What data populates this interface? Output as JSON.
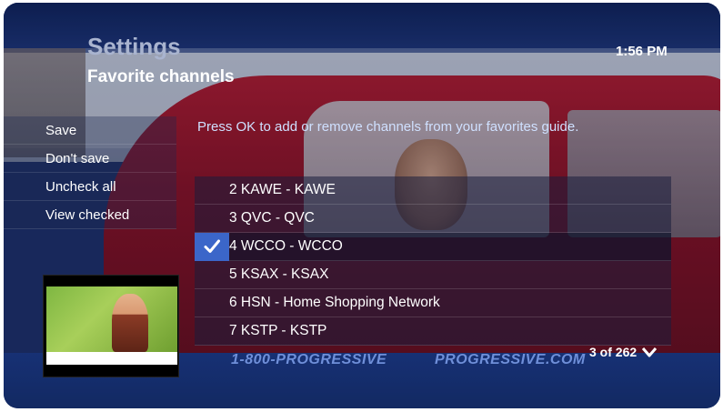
{
  "header": {
    "title": "Settings",
    "subtitle": "Favorite channels",
    "clock": "1:56 PM"
  },
  "instruction": "Press OK to add or remove channels from your favorites guide.",
  "menu": {
    "items": [
      {
        "label": "Save"
      },
      {
        "label": "Don't save"
      },
      {
        "label": "Uncheck all"
      },
      {
        "label": "View checked"
      }
    ]
  },
  "channels": {
    "rows": [
      {
        "label": "2 KAWE - KAWE",
        "checked": false
      },
      {
        "label": "3 QVC - QVC",
        "checked": false
      },
      {
        "label": "4 WCCO - WCCO",
        "checked": true
      },
      {
        "label": "5 KSAX - KSAX",
        "checked": false
      },
      {
        "label": "6 HSN - Home Shopping Network",
        "checked": false
      },
      {
        "label": "7 KSTP - KSTP",
        "checked": false
      }
    ],
    "pager": "3 of 262"
  },
  "ad": {
    "phone": "1-800-PROGRESSIVE",
    "site": "PROGRESSIVE.COM"
  },
  "icons": {
    "check": "checkmark-icon",
    "scroll_down": "chevron-down-icon"
  },
  "colors": {
    "accent": "#3b66c9",
    "background": "#1d2f66",
    "title": "#a9b4cf"
  }
}
